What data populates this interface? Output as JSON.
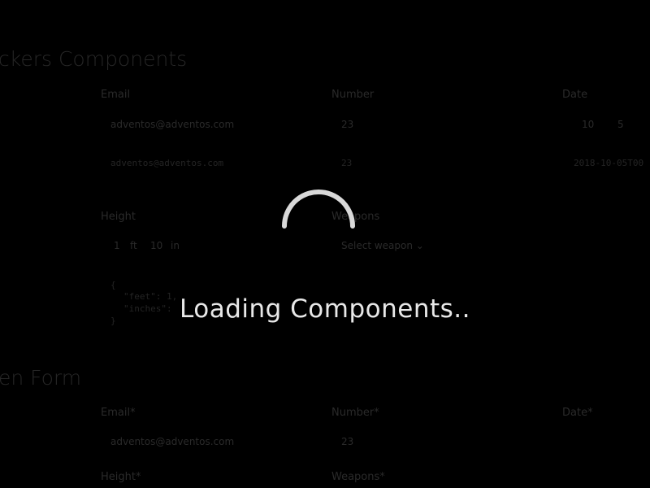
{
  "background": {
    "section1": {
      "title": "ckers Components",
      "email_label": "Email",
      "number_label": "Number",
      "date_label": "Date",
      "email_value": "adventos@adventos.com",
      "number_value": "23",
      "date_day": "10",
      "date_month": "5",
      "email_output": "adventos@adventos.com",
      "number_output": "23",
      "date_output": "2018-10-05T00",
      "height_label": "Height",
      "weapons_label": "Weapons",
      "height_feet": "1",
      "height_feet_unit": "ft",
      "height_inches": "10",
      "height_inches_unit": "in",
      "weapon_placeholder": "Select weapon",
      "json_open": "{",
      "json_feet": "\"feet\": 1,",
      "json_inches": "\"inches\":",
      "json_close": "}"
    },
    "section2": {
      "title": "en Form",
      "email_label": "Email*",
      "number_label": "Number*",
      "date_label": "Date*",
      "email_value": "adventos@adventos.com",
      "number_value": "23",
      "height_label": "Height*",
      "weapons_label": "Weapons*"
    }
  },
  "overlay": {
    "loading_text": "Loading Components..",
    "spinner_color": "#d9d9d9",
    "backdrop_color": "#000000"
  }
}
